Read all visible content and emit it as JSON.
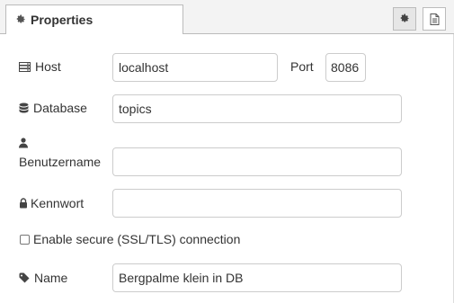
{
  "tabs": {
    "properties_label": "Properties"
  },
  "form": {
    "host": {
      "label": "Host",
      "value": "localhost"
    },
    "port": {
      "label": "Port",
      "value": "8086"
    },
    "database": {
      "label": "Database",
      "value": "topics"
    },
    "username": {
      "label": "Benutzername",
      "value": ""
    },
    "password": {
      "label": "Kennwort",
      "value": ""
    },
    "ssl": {
      "label": "Enable secure (SSL/TLS) connection",
      "checked": false
    },
    "name": {
      "label": "Name",
      "value": "Bergpalme klein in DB"
    }
  },
  "icons": {
    "tab": "gear-icon",
    "settings_button": "gear-icon",
    "description_button": "document-icon",
    "host": "server-icon",
    "database": "database-icon",
    "username": "user-icon",
    "password": "lock-icon",
    "name": "tag-icon"
  }
}
